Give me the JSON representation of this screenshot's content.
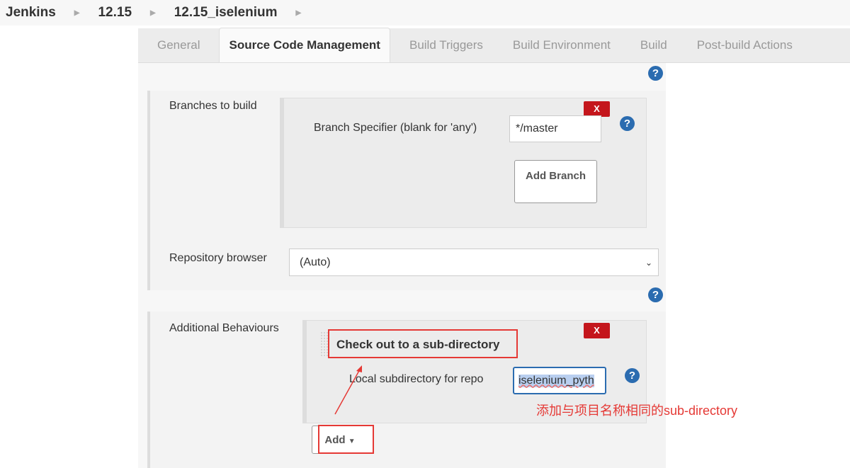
{
  "breadcrumb": [
    "Jenkins",
    "12.15",
    "12.15_iselenium"
  ],
  "tabs": [
    {
      "label": "General"
    },
    {
      "label": "Source Code Management",
      "active": true
    },
    {
      "label": "Build Triggers"
    },
    {
      "label": "Build Environment"
    },
    {
      "label": "Build"
    },
    {
      "label": "Post-build Actions"
    }
  ],
  "branches": {
    "label": "Branches to build",
    "specifier_label": "Branch Specifier (blank for 'any')",
    "specifier_value": "*/master",
    "add_branch": "Add Branch",
    "delete": "X"
  },
  "repo_browser": {
    "label": "Repository browser",
    "value": "(Auto)"
  },
  "additional": {
    "label": "Additional Behaviours",
    "title": "Check out to a sub-directory",
    "subdir_label": "Local subdirectory for repo",
    "subdir_value": "iselenium_pyth",
    "delete": "X",
    "add": "Add"
  },
  "annotation": {
    "text": "添加与项目名称相同的sub-directory",
    "color": "#e53935"
  },
  "help": "?"
}
